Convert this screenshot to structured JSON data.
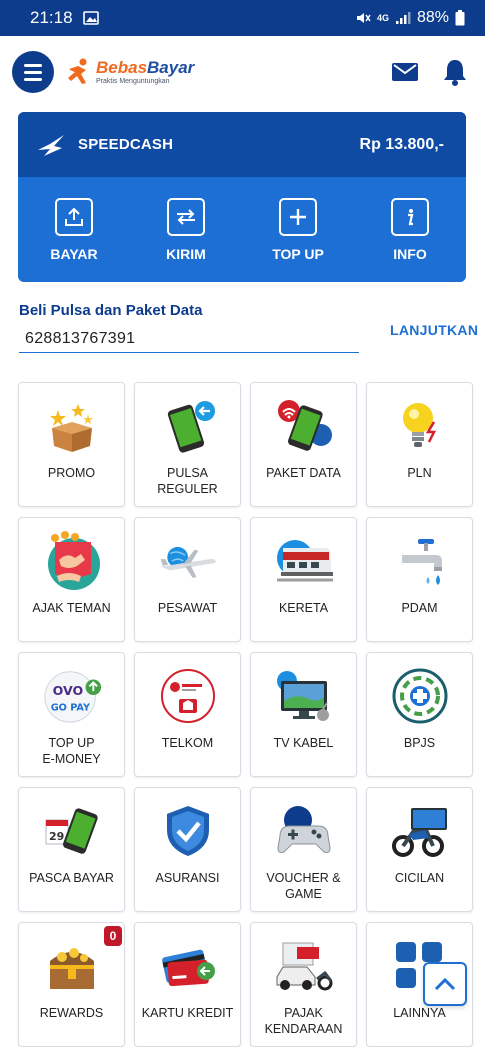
{
  "status_bar": {
    "time": "21:18",
    "battery": "88%",
    "network": "4G"
  },
  "header": {
    "logo_name_a": "Bebas",
    "logo_name_b": "Bayar",
    "logo_tagline": "Praktis Menguntungkan"
  },
  "card": {
    "brand": "SPEEDCASH",
    "balance": "Rp 13.800,-",
    "actions": [
      {
        "label": "BAYAR",
        "icon": "upload-icon"
      },
      {
        "label": "KIRIM",
        "icon": "transfer-icon"
      },
      {
        "label": "TOP UP",
        "icon": "plus-icon"
      },
      {
        "label": "INFO",
        "icon": "info-icon"
      }
    ]
  },
  "pulsa": {
    "title": "Beli Pulsa dan Paket Data",
    "phone": "628813767391",
    "action": "LANJUTKAN"
  },
  "menu": [
    {
      "label": "PROMO",
      "icon": "gift-box-icon"
    },
    {
      "label": "PULSA\nREGULER",
      "icon": "phone-pulsa-icon"
    },
    {
      "label": "PAKET DATA",
      "icon": "phone-data-icon"
    },
    {
      "label": "PLN",
      "icon": "lightbulb-icon"
    },
    {
      "label": "AJAK TEMAN",
      "icon": "invite-friend-icon"
    },
    {
      "label": "PESAWAT",
      "icon": "airplane-icon"
    },
    {
      "label": "KERETA",
      "icon": "train-icon"
    },
    {
      "label": "PDAM",
      "icon": "water-tap-icon"
    },
    {
      "label": "TOP UP\nE-MONEY",
      "icon": "ovo-gopay-icon"
    },
    {
      "label": "TELKOM",
      "icon": "telkom-icon"
    },
    {
      "label": "TV KABEL",
      "icon": "tv-icon"
    },
    {
      "label": "BPJS",
      "icon": "bpjs-icon"
    },
    {
      "label": "PASCA BAYAR",
      "icon": "phone-calendar-icon"
    },
    {
      "label": "ASURANSI",
      "icon": "shield-check-icon"
    },
    {
      "label": "VOUCHER &\nGAME",
      "icon": "gamepad-icon"
    },
    {
      "label": "CICILAN",
      "icon": "motorcycle-icon"
    },
    {
      "label": "REWARDS",
      "icon": "treasure-chest-icon",
      "badge": "0"
    },
    {
      "label": "KARTU KREDIT",
      "icon": "credit-card-icon"
    },
    {
      "label": "PAJAK\nKENDARAAN",
      "icon": "car-tax-icon"
    },
    {
      "label": "LAINNYA",
      "icon": "more-grid-icon"
    }
  ],
  "colors": {
    "primary": "#0e3c8d",
    "accent": "#1d6fd3",
    "brand_orange": "#ef6a1f",
    "badge": "#c0172b"
  }
}
